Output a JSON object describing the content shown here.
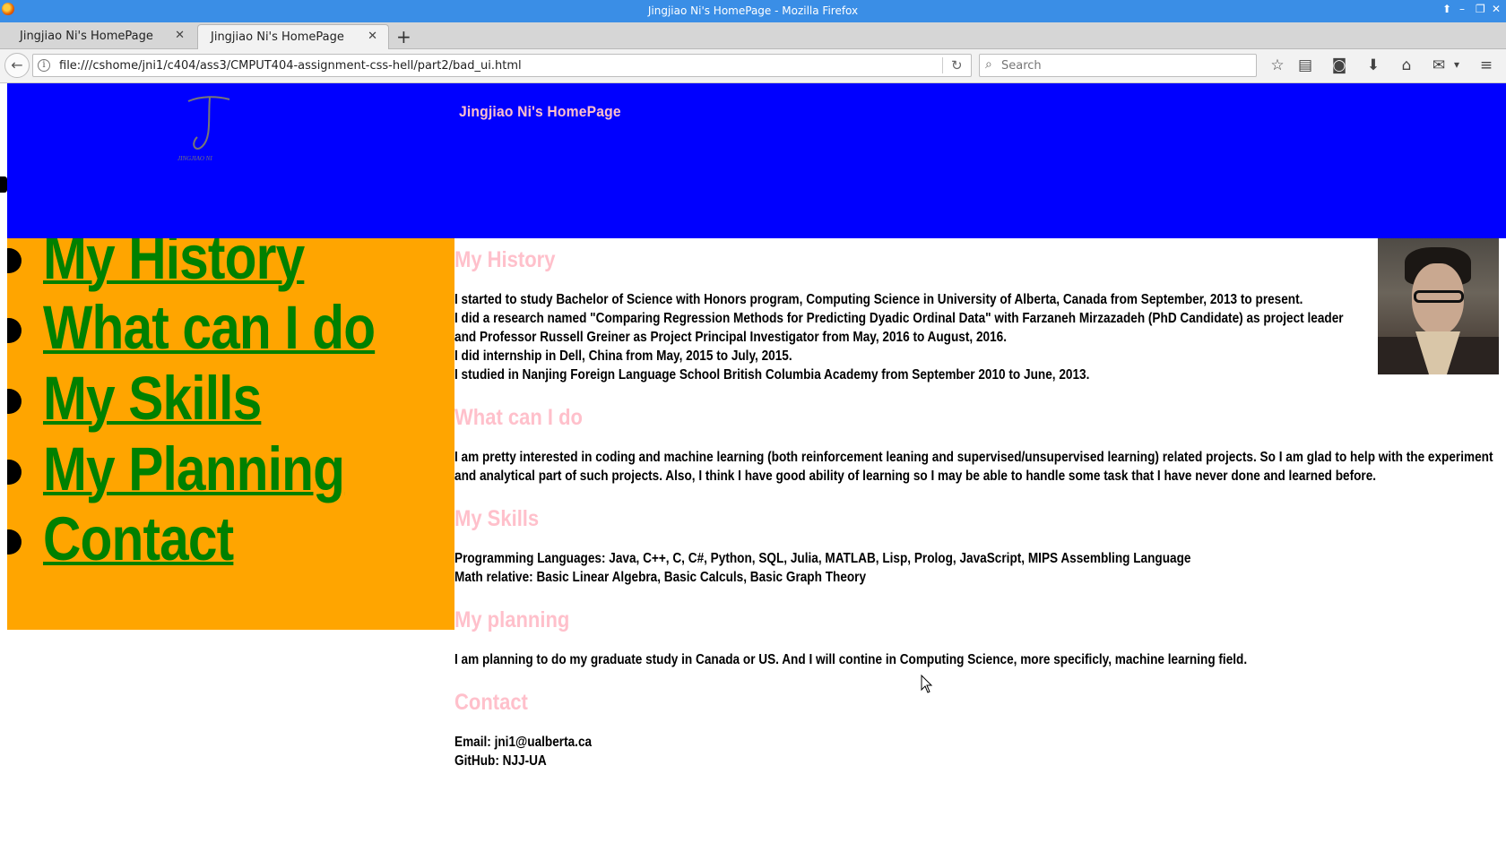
{
  "window": {
    "title": "Jingjiao Ni's HomePage - Mozilla Firefox",
    "controls": [
      "⬆",
      "–",
      "❐",
      "✕"
    ]
  },
  "tabs": [
    {
      "label": "Jingjiao Ni's HomePage",
      "active": false,
      "close": "✕"
    },
    {
      "label": "Jingjiao Ni's HomePage",
      "active": true,
      "close": "✕"
    }
  ],
  "newtab_label": "+",
  "navbar": {
    "back": "←",
    "info": "i",
    "url": "file:///cshome/jni1/c404/ass3/CMPUT404-assignment-css-hell/part2/bad_ui.html",
    "reload": "↻",
    "search_icon": "⌕",
    "search_placeholder": "Search",
    "toolbar_icons": [
      "☆",
      "▤",
      "◙",
      "⬇",
      "⌂",
      "✉",
      "▾",
      "≡"
    ]
  },
  "page": {
    "site_title": "Jingjiao Ni's HomePage",
    "nav": [
      "My History",
      "What can I do",
      "My Skills",
      "My Planning",
      "Contact"
    ],
    "sections": [
      {
        "heading": "My History",
        "lines": [
          "I started to study Bachelor of Science with Honors program, Computing Science in University of Alberta, Canada from September, 2013 to present.",
          "I did a research named \"Comparing Regression Methods for Predicting Dyadic Ordinal Data\" with Farzaneh Mirzazadeh (PhD Candidate) as project leader",
          "and Professor Russell Greiner as Project Principal Investigator from May, 2016 to August, 2016.",
          "I did internship in Dell, China from May, 2015 to July, 2015.",
          "I studied in Nanjing Foreign Language School British Columbia Academy from September 2010 to June, 2013."
        ]
      },
      {
        "heading": "What can I do",
        "lines": [
          "I am pretty interested in coding and machine learning (both reinforcement leaning and supervised/unsupervised learning) related projects. So I am glad to help with the experiment",
          "and analytical part of such projects. Also, I think I have good ability of learning so I may be able to handle some task that I have never done and learned before."
        ]
      },
      {
        "heading": "My Skills",
        "lines": [
          "Programming Languages: Java, C++, C, C#, Python, SQL, Julia, MATLAB, Lisp, Prolog, JavaScript, MIPS Assembling Language",
          "Math relative: Basic Linear Algebra, Basic Calculs, Basic Graph Theory"
        ]
      },
      {
        "heading": "My planning",
        "lines": [
          "I am planning to do my graduate study in Canada or US. And I will contine in Computing Science, more specificly, machine learning field."
        ]
      },
      {
        "heading": "Contact",
        "lines": [
          "Email: jni1@ualberta.ca",
          "GitHub: NJJ-UA"
        ]
      }
    ]
  },
  "colors": {
    "header_bg": "#0000ff",
    "sidebar_bg": "#ffa500",
    "nav_link": "#008000",
    "heading": "#ffc0cb"
  }
}
